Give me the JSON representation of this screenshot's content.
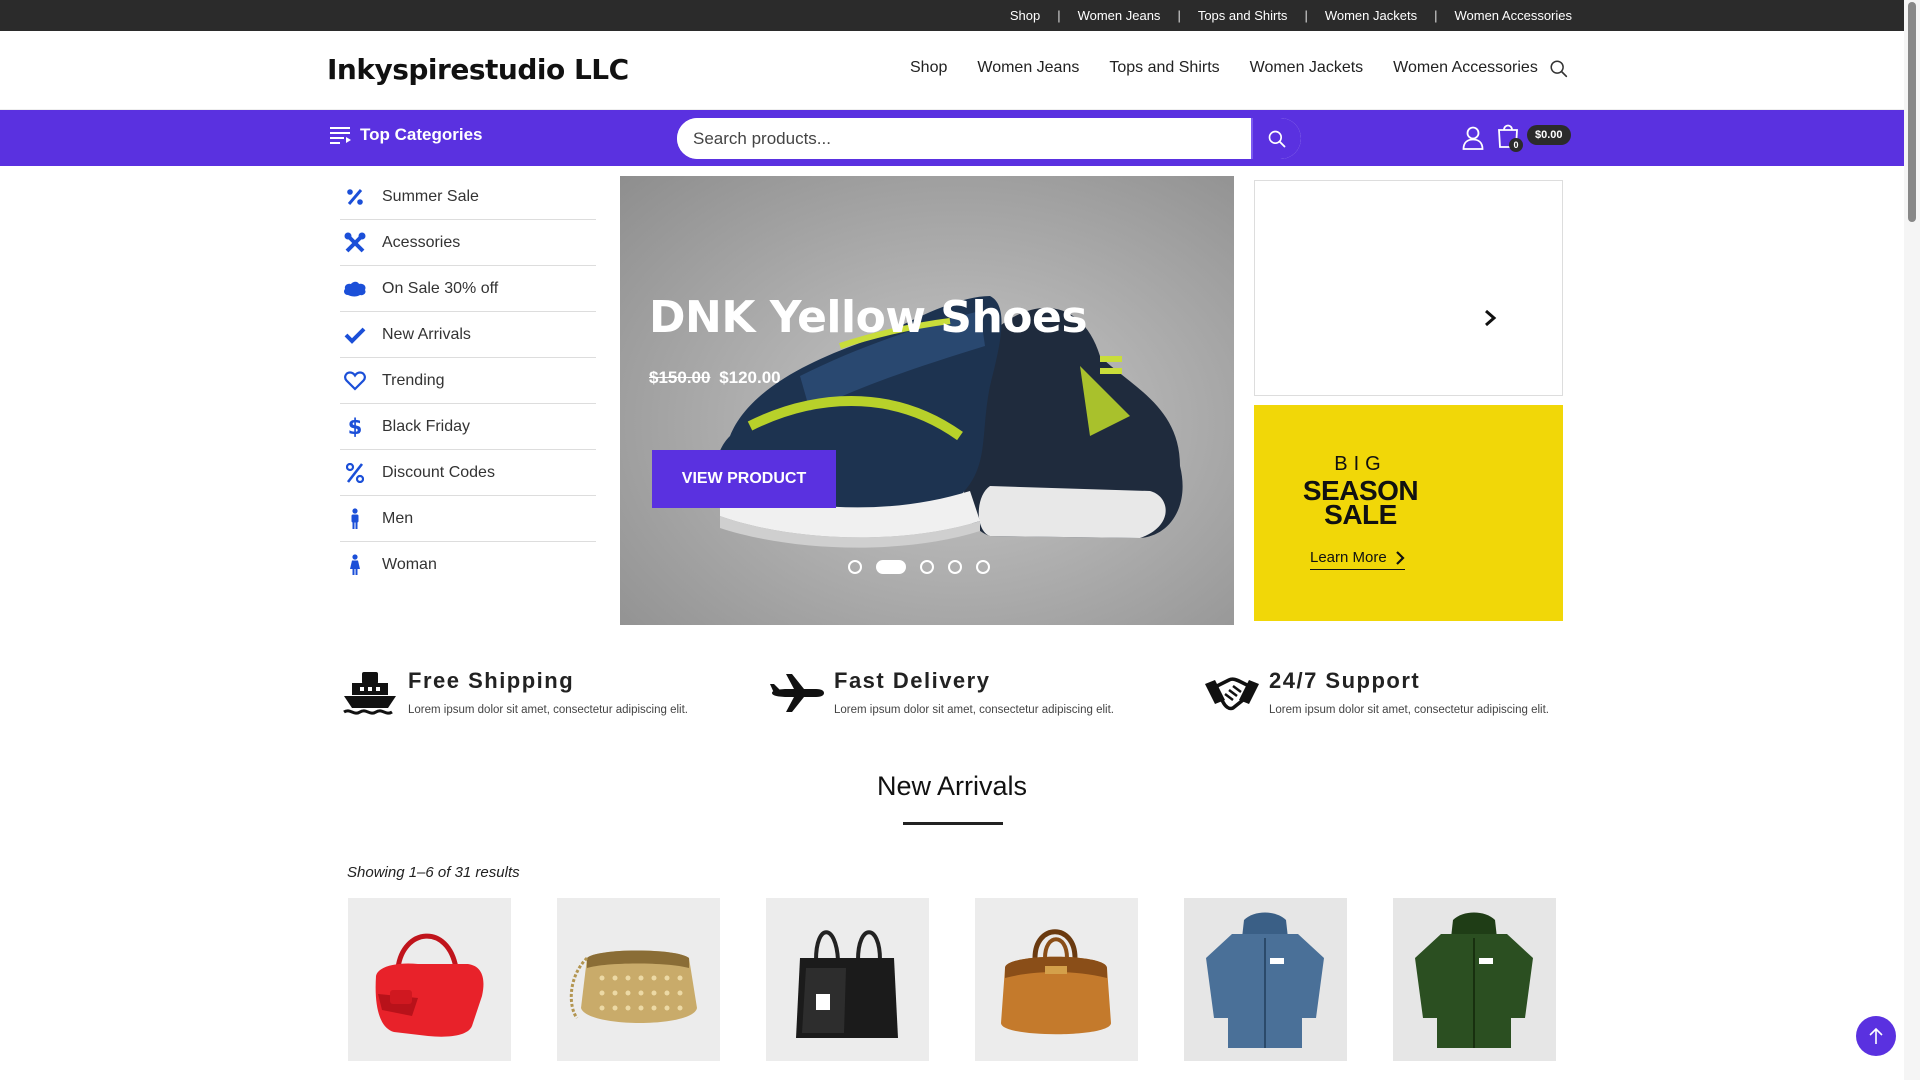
{
  "topbar": {
    "links": [
      "Shop",
      "Women Jeans",
      "Tops and Shirts",
      "Women Jackets",
      "Women Accessories"
    ],
    "separator": "|"
  },
  "header": {
    "brand": "Inkyspirestudio LLC",
    "nav": [
      "Shop",
      "Women Jeans",
      "Tops and Shirts",
      "Women Jackets",
      "Women Accessories"
    ]
  },
  "toolbar": {
    "categories_label": "Top Categories",
    "search_placeholder": "Search products...",
    "cart_count": "0",
    "cart_total": "$0.00"
  },
  "categories": [
    {
      "label": "Summer Sale",
      "icon": "percent-icon"
    },
    {
      "label": "Acessories",
      "icon": "tools-icon"
    },
    {
      "label": "On Sale 30% off",
      "icon": "salesforce-icon"
    },
    {
      "label": "New Arrivals",
      "icon": "check-icon"
    },
    {
      "label": "Trending",
      "icon": "heart-icon"
    },
    {
      "label": "Black Friday",
      "icon": "dollar-icon"
    },
    {
      "label": "Discount Codes",
      "icon": "percent-icon"
    },
    {
      "label": "Men",
      "icon": "male-icon"
    },
    {
      "label": "Woman",
      "icon": "female-icon"
    }
  ],
  "hero": {
    "title": "DNK Yellow Shoes",
    "old_price": "$150.00",
    "price": "$120.00",
    "button": "VIEW PRODUCT",
    "slide_count": 5,
    "active_slide": 2
  },
  "promo": {
    "big": "BIG",
    "season": "SEASON",
    "sale": "SALE",
    "link": "Learn More"
  },
  "features": [
    {
      "title": "Free Shipping",
      "text": "Lorem ipsum dolor sit amet, consectetur adipiscing elit.",
      "icon": "ship-icon"
    },
    {
      "title": "Fast Delivery",
      "text": "Lorem ipsum dolor sit amet, consectetur adipiscing elit.",
      "icon": "plane-icon"
    },
    {
      "title": "24/7 Support",
      "text": "Lorem ipsum dolor sit amet, consectetur adipiscing elit.",
      "icon": "handshake-icon"
    }
  ],
  "new_arrivals": {
    "title": "New Arrivals",
    "results_text": "Showing 1–6 of 31 results",
    "products": [
      "red-handbag",
      "gold-mesh-purse",
      "black-tote-bag",
      "brown-duffel-bag",
      "blue-hoodie",
      "green-hoodie"
    ]
  },
  "colors": {
    "accent": "#5a31e0",
    "topbar": "#2b2b2b",
    "promo_yellow": "#f1d708",
    "icon_blue": "#1b4fd8"
  }
}
